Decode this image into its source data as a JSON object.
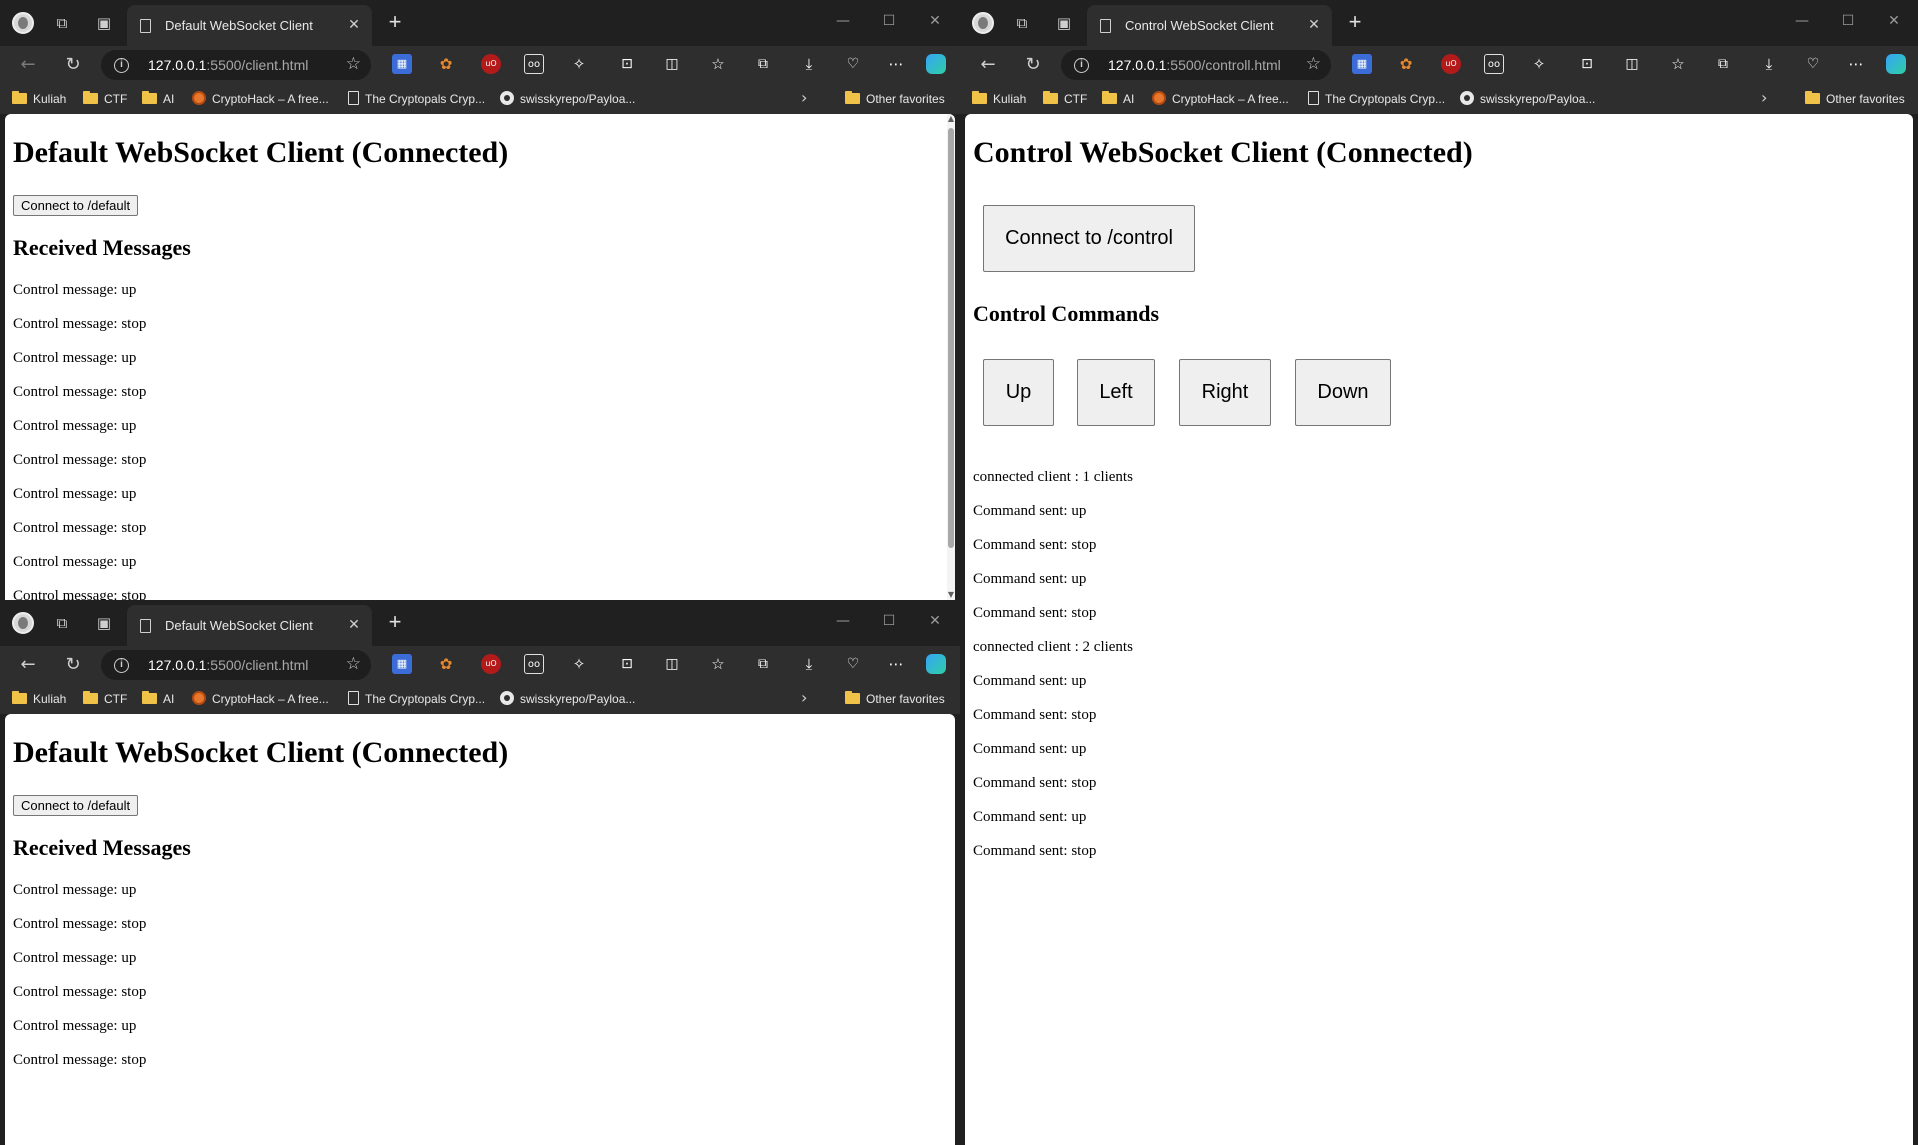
{
  "colors": {
    "chrome_dark": "#202020",
    "toolbar": "#2e2e2e",
    "page_bg": "#ffffff",
    "folder": "#f0c348"
  },
  "bookmarks": {
    "kuliah": "Kuliah",
    "ctf": "CTF",
    "ai": "AI",
    "cryptohack": "CryptoHack – A free...",
    "cryptopals": "The Cryptopals Cryp...",
    "payloads": "swisskyrepo/Payloa...",
    "other": "Other favorites"
  },
  "icons": {
    "workspaces": "workspaces-icon",
    "tab_actions": "tab-actions-icon",
    "back": "back-arrow-icon",
    "refresh": "refresh-icon",
    "info": "site-info-icon",
    "favorite": "star-icon",
    "more": "more-icon",
    "copilot": "copilot-icon"
  },
  "window_a": {
    "tab_title": "Default WebSocket Client",
    "url_host": "127.0.0.1",
    "url_rest": ":5500/client.html",
    "heading": "Default WebSocket Client (Connected)",
    "connect_button": "Connect to /default",
    "messages_heading": "Received Messages",
    "messages": [
      "Control message: up",
      "Control message: stop",
      "Control message: up",
      "Control message: stop",
      "Control message: up",
      "Control message: stop",
      "Control message: up",
      "Control message: stop",
      "Control message: up",
      "Control message: stop"
    ]
  },
  "window_b": {
    "tab_title": "Default WebSocket Client",
    "url_host": "127.0.0.1",
    "url_rest": ":5500/client.html",
    "heading": "Default WebSocket Client (Connected)",
    "connect_button": "Connect to /default",
    "messages_heading": "Received Messages",
    "messages": [
      "Control message: up",
      "Control message: stop",
      "Control message: up",
      "Control message: stop",
      "Control message: up",
      "Control message: stop"
    ]
  },
  "window_c": {
    "tab_title": "Control WebSocket Client",
    "url_host": "127.0.0.1",
    "url_rest": ":5500/controll.html",
    "heading": "Control WebSocket Client (Connected)",
    "connect_button": "Connect to /control",
    "commands_heading": "Control Commands",
    "commands": {
      "up": "Up",
      "left": "Left",
      "right": "Right",
      "down": "Down"
    },
    "log": [
      "connected client : 1 clients",
      "Command sent: up",
      "Command sent: stop",
      "Command sent: up",
      "Command sent: stop",
      "connected client : 2 clients",
      "Command sent: up",
      "Command sent: stop",
      "Command sent: up",
      "Command sent: stop",
      "Command sent: up",
      "Command sent: stop"
    ]
  }
}
